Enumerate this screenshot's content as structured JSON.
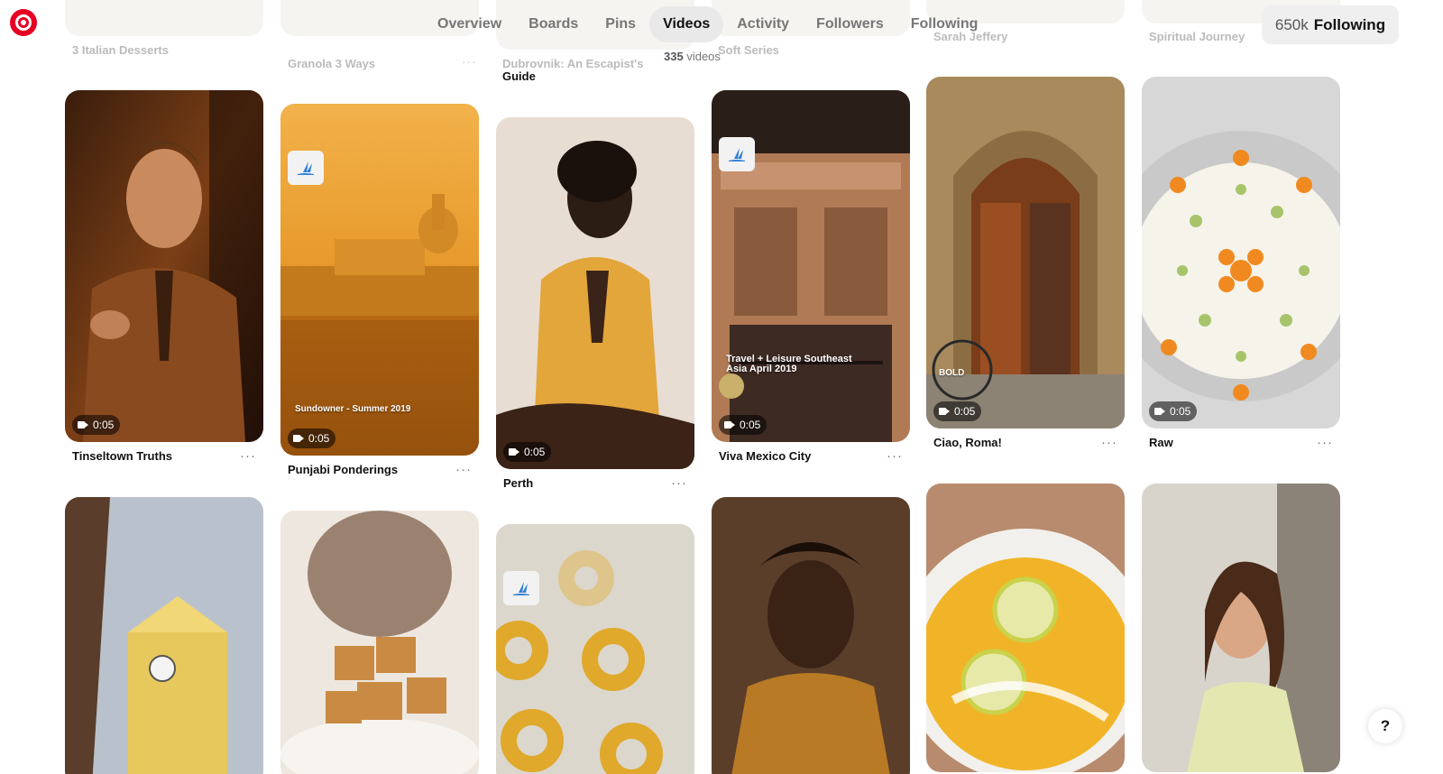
{
  "nav": {
    "tabs": [
      "Overview",
      "Boards",
      "Pins",
      "Videos",
      "Activity",
      "Followers",
      "Following"
    ],
    "active_tab": "Videos",
    "video_count": "335",
    "video_count_label": "videos"
  },
  "follow": {
    "count": "650k",
    "label": "Following"
  },
  "top_row_faded": {
    "titles": [
      "3 Italian Desserts",
      "Granola 3 Ways",
      "Dubrovnik: An Escapist's",
      "Soft Series",
      "Sarah Jeffery",
      "Spiritual Journey"
    ],
    "guide_text": "Guide"
  },
  "pins_row1": [
    {
      "title": "Tinseltown Truths",
      "duration": "0:05"
    },
    {
      "title": "Punjabi Ponderings",
      "duration": "0:05",
      "overlay_text": "Sundowner - Summer 2019"
    },
    {
      "title": "Perth",
      "duration": "0:05"
    },
    {
      "title": "Viva Mexico City",
      "duration": "0:05",
      "overlay_text": "Travel + Leisure Southeast Asia April 2019"
    },
    {
      "title": "Ciao, Roma!",
      "duration": "0:05",
      "overlay_text": "BOLD"
    },
    {
      "title": "Raw",
      "duration": "0:05"
    }
  ],
  "more_glyph": "···",
  "help_label": "?",
  "colors": {
    "brand_red": "#e60023",
    "active_tab_bg": "#e9e9e9",
    "muted_text": "#767676"
  }
}
